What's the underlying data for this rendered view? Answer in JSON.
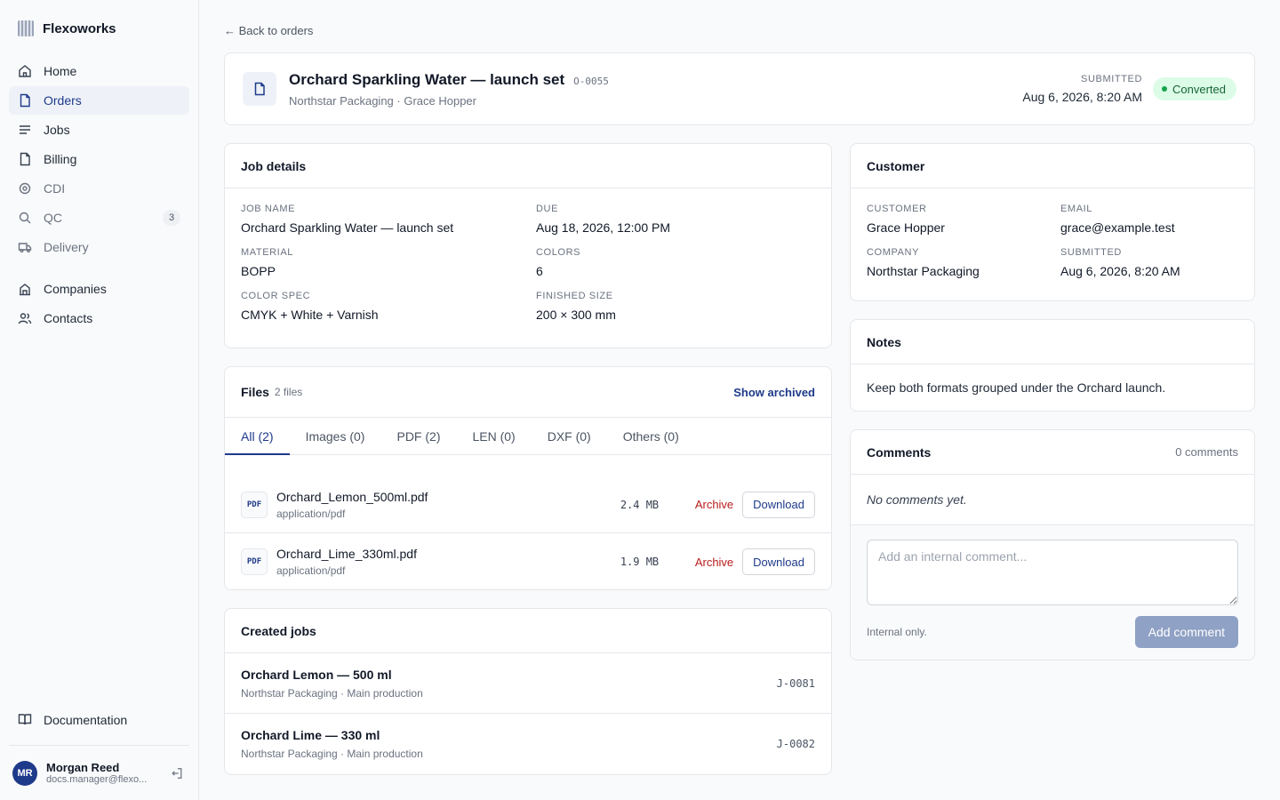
{
  "brand": {
    "name": "Flexoworks"
  },
  "nav": {
    "home": "Home",
    "orders": "Orders",
    "jobs": "Jobs",
    "billing": "Billing",
    "cdi": "CDI",
    "qc": "QC",
    "qc_badge": "3",
    "delivery": "Delivery",
    "companies": "Companies",
    "contacts": "Contacts",
    "documentation": "Documentation"
  },
  "user": {
    "initials": "MR",
    "name": "Morgan Reed",
    "email": "docs.manager@flexo..."
  },
  "back_link": "← Back to orders",
  "order": {
    "title": "Orchard Sparkling Water — launch set",
    "code": "O-0055",
    "subtitle": "Northstar Packaging · Grace Hopper",
    "submitted_label": "SUBMITTED",
    "submitted_value": "Aug 6, 2026, 8:20 AM",
    "status": "Converted"
  },
  "job_details": {
    "title": "Job details",
    "fields": [
      {
        "label": "JOB NAME",
        "value": "Orchard Sparkling Water — launch set"
      },
      {
        "label": "DUE",
        "value": "Aug 18, 2026, 12:00 PM"
      },
      {
        "label": "MATERIAL",
        "value": "BOPP"
      },
      {
        "label": "COLORS",
        "value": "6"
      },
      {
        "label": "COLOR SPEC",
        "value": "CMYK + White + Varnish"
      },
      {
        "label": "FINISHED SIZE",
        "value": "200 × 300 mm"
      }
    ]
  },
  "customer": {
    "title": "Customer",
    "fields": [
      {
        "label": "CUSTOMER",
        "value": "Grace Hopper"
      },
      {
        "label": "EMAIL",
        "value": "grace@example.test"
      },
      {
        "label": "COMPANY",
        "value": "Northstar Packaging"
      },
      {
        "label": "SUBMITTED",
        "value": "Aug 6, 2026, 8:20 AM"
      }
    ]
  },
  "notes": {
    "title": "Notes",
    "body": "Keep both formats grouped under the Orchard launch."
  },
  "comments": {
    "title": "Comments",
    "count": "0 comments",
    "empty": "No comments yet.",
    "placeholder": "Add an internal comment...",
    "hint": "Internal only.",
    "submit": "Add comment"
  },
  "files": {
    "title": "Files",
    "count": "2 files",
    "show_archived": "Show archived",
    "tabs": [
      "All (2)",
      "Images (0)",
      "PDF (2)",
      "LEN (0)",
      "DXF (0)",
      "Others (0)"
    ],
    "items": [
      {
        "badge": "PDF",
        "name": "Orchard_Lemon_500ml.pdf",
        "type": "application/pdf",
        "size": "2.4 MB",
        "archive": "Archive",
        "download": "Download"
      },
      {
        "badge": "PDF",
        "name": "Orchard_Lime_330ml.pdf",
        "type": "application/pdf",
        "size": "1.9 MB",
        "archive": "Archive",
        "download": "Download"
      }
    ]
  },
  "created_jobs": {
    "title": "Created jobs",
    "items": [
      {
        "name": "Orchard Lemon — 500 ml",
        "sub": "Northstar Packaging · Main production",
        "code": "J-0081"
      },
      {
        "name": "Orchard Lime — 330 ml",
        "sub": "Northstar Packaging · Main production",
        "code": "J-0082"
      }
    ]
  }
}
